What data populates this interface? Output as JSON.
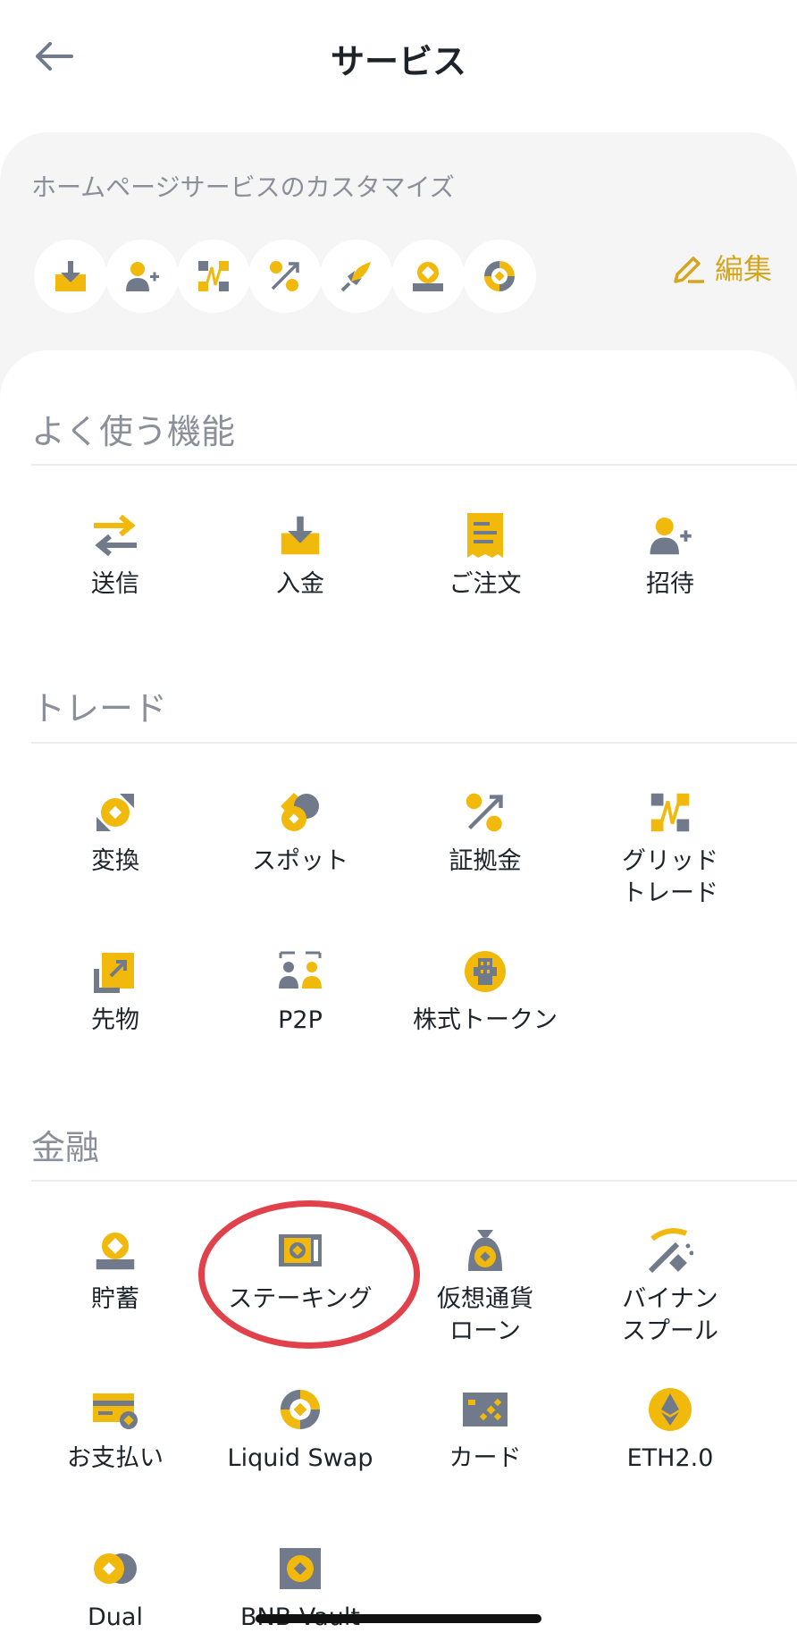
{
  "header": {
    "title": "サービス",
    "back_icon": "back-arrow-icon"
  },
  "customize": {
    "label": "ホームページサービスのカスタマイズ",
    "edit_label": "編集",
    "quick_icons": [
      "deposit-icon",
      "invite-icon",
      "grid-trade-icon",
      "margin-icon",
      "launchpad-icon",
      "savings-icon",
      "liquid-swap-icon"
    ]
  },
  "sections": {
    "frequent": {
      "title": "よく使う機能",
      "items": [
        {
          "label": "送信",
          "icon": "transfer-icon"
        },
        {
          "label": "入金",
          "icon": "deposit-icon"
        },
        {
          "label": "ご注文",
          "icon": "orders-icon"
        },
        {
          "label": "招待",
          "icon": "invite-icon"
        }
      ]
    },
    "trade": {
      "title": "トレード",
      "items": [
        {
          "label": "変換",
          "icon": "convert-icon"
        },
        {
          "label": "スポット",
          "icon": "spot-icon"
        },
        {
          "label": "証拠金",
          "icon": "margin-icon"
        },
        {
          "label": "グリッド\nトレード",
          "icon": "grid-trade-icon"
        },
        {
          "label": "先物",
          "icon": "futures-icon"
        },
        {
          "label": "P2P",
          "icon": "p2p-icon"
        },
        {
          "label": "株式トークン",
          "icon": "stock-token-icon"
        }
      ]
    },
    "finance": {
      "title": "金融",
      "items": [
        {
          "label": "貯蓄",
          "icon": "savings-icon"
        },
        {
          "label": "ステーキング",
          "icon": "staking-icon"
        },
        {
          "label": "仮想通貨\nローン",
          "icon": "crypto-loan-icon"
        },
        {
          "label": "バイナン\nスプール",
          "icon": "pool-icon"
        },
        {
          "label": "お支払い",
          "icon": "pay-icon"
        },
        {
          "label": "Liquid Swap",
          "icon": "liquid-swap-icon"
        },
        {
          "label": "カード",
          "icon": "card-icon"
        },
        {
          "label": "ETH2.0",
          "icon": "eth2-icon"
        },
        {
          "label": "Dual",
          "icon": "dual-icon"
        },
        {
          "label": "BNB Vault",
          "icon": "bnb-vault-icon"
        }
      ]
    }
  },
  "colors": {
    "accent": "#F0B90B",
    "gray_icon": "#707A8A",
    "highlight_ring": "#E0414A"
  }
}
